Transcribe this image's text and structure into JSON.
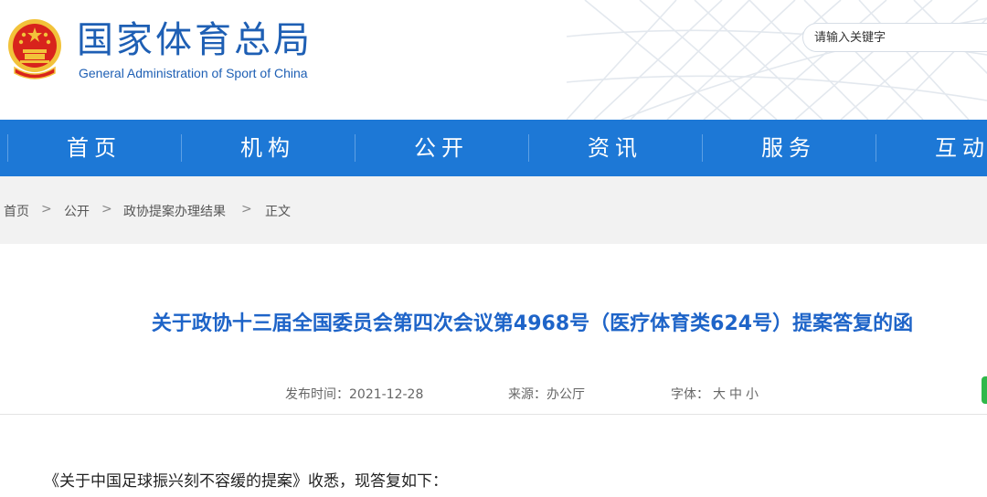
{
  "header": {
    "title_cn": "国家体育总局",
    "title_en": "General Administration of Sport of China",
    "logo_icon": "national-emblem-icon",
    "search_placeholder": "请输入关键字"
  },
  "nav": {
    "items": [
      {
        "label": "首页"
      },
      {
        "label": "机构"
      },
      {
        "label": "公开"
      },
      {
        "label": "资讯"
      },
      {
        "label": "服务"
      },
      {
        "label": "互动"
      }
    ]
  },
  "breadcrumb": {
    "items": [
      "首页",
      "公开",
      "政协提案办理结果",
      "正文"
    ],
    "separator": ">"
  },
  "article": {
    "title": "关于政协十三届全国委员会第四次会议第4968号（医疗体育类624号）提案答复的函",
    "publish_label": "发布时间：",
    "publish_date": "2021-12-28",
    "source_label": "来源：",
    "source": "办公厅",
    "font_label": "字体：",
    "font_sizes": [
      "大",
      "中",
      "小"
    ],
    "body_first_line": "《关于中国足球振兴刻不容缓的提案》收悉，现答复如下："
  },
  "colors": {
    "brand_blue": "#1d78d6",
    "title_blue": "#1e64c8",
    "emblem_red": "#d8231c",
    "emblem_gold": "#f2c23a"
  }
}
